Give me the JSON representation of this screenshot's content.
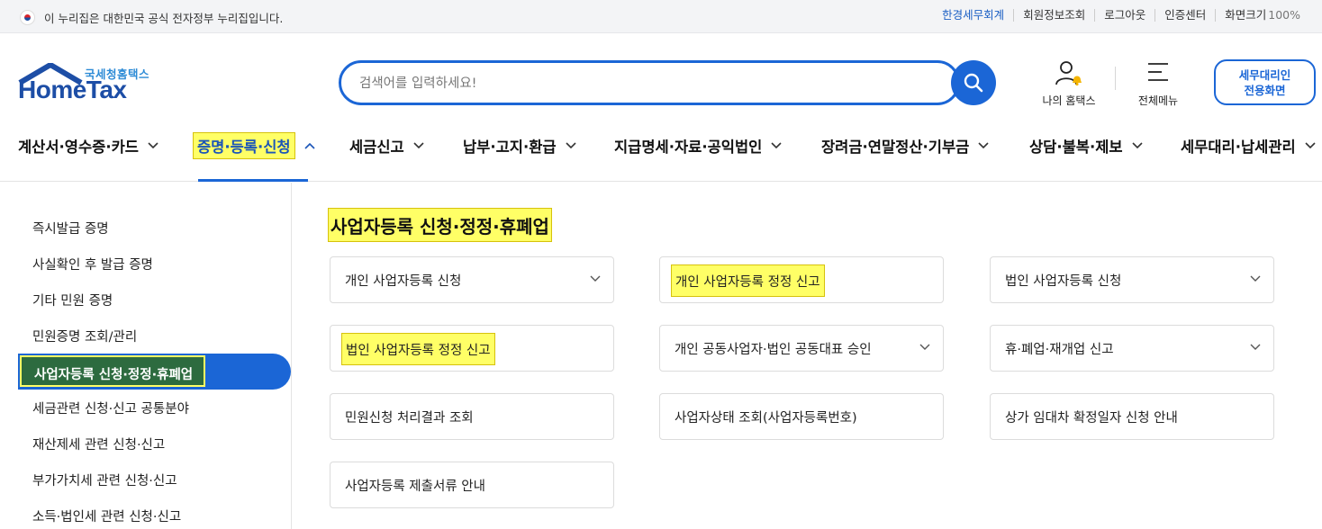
{
  "topbar": {
    "gov_notice": "이 누리집은 대한민국 공식 전자정부 누리집입니다.",
    "links": [
      "한경세무회계",
      "회원정보조회",
      "로그아웃",
      "인증센터"
    ],
    "zoom_label": "화면크기",
    "zoom_value": "100%"
  },
  "header": {
    "logo_kr": "국세청홈택스",
    "logo_en": "HomeTax",
    "search_placeholder": "검색어를 입력하세요!",
    "my_hometax": "나의 홈택스",
    "all_menu": "전체메뉴",
    "agent_line1": "세무대리인",
    "agent_line2": "전용화면"
  },
  "gnb": {
    "items": [
      "계산서·영수증·카드",
      "증명·등록·신청",
      "세금신고",
      "납부·고지·환급",
      "지급명세·자료·공익법인",
      "장려금·연말정산·기부금",
      "상담·불복·제보",
      "세무대리·납세관리"
    ],
    "active_index": 1
  },
  "sidebar": {
    "items": [
      "즉시발급 증명",
      "사실확인 후 발급 증명",
      "기타 민원 증명",
      "민원증명 조회/관리",
      "사업자등록 신청·정정·휴폐업",
      "세금관련 신청·신고 공통분야",
      "재산제세 관련 신청·신고",
      "부가가치세 관련 신청·신고",
      "소득·법인세 관련 신청·신고"
    ],
    "active_index": 4
  },
  "content": {
    "title": "사업자등록 신청·정정·휴폐업",
    "cards": [
      {
        "label": "개인 사업자등록 신청",
        "chevron": true,
        "highlight": false
      },
      {
        "label": "개인 사업자등록 정정 신고",
        "chevron": false,
        "highlight": true
      },
      {
        "label": "법인 사업자등록 신청",
        "chevron": true,
        "highlight": false
      },
      {
        "label": "법인 사업자등록 정정 신고",
        "chevron": false,
        "highlight": true
      },
      {
        "label": "개인 공동사업자·법인 공동대표 승인",
        "chevron": true,
        "highlight": false
      },
      {
        "label": "휴·폐업·재개업 신고",
        "chevron": true,
        "highlight": false
      },
      {
        "label": "민원신청 처리결과 조회",
        "chevron": false,
        "highlight": false
      },
      {
        "label": "사업자상태 조회(사업자등록번호)",
        "chevron": false,
        "highlight": false
      },
      {
        "label": "상가 임대차 확정일자 신청 안내",
        "chevron": false,
        "highlight": false
      },
      {
        "label": "사업자등록 제출서류 안내",
        "chevron": false,
        "highlight": false
      }
    ]
  },
  "colors": {
    "accent": "#1b66d6",
    "highlight": "#ffff66",
    "active_text_bg": "#2d6b3f"
  }
}
